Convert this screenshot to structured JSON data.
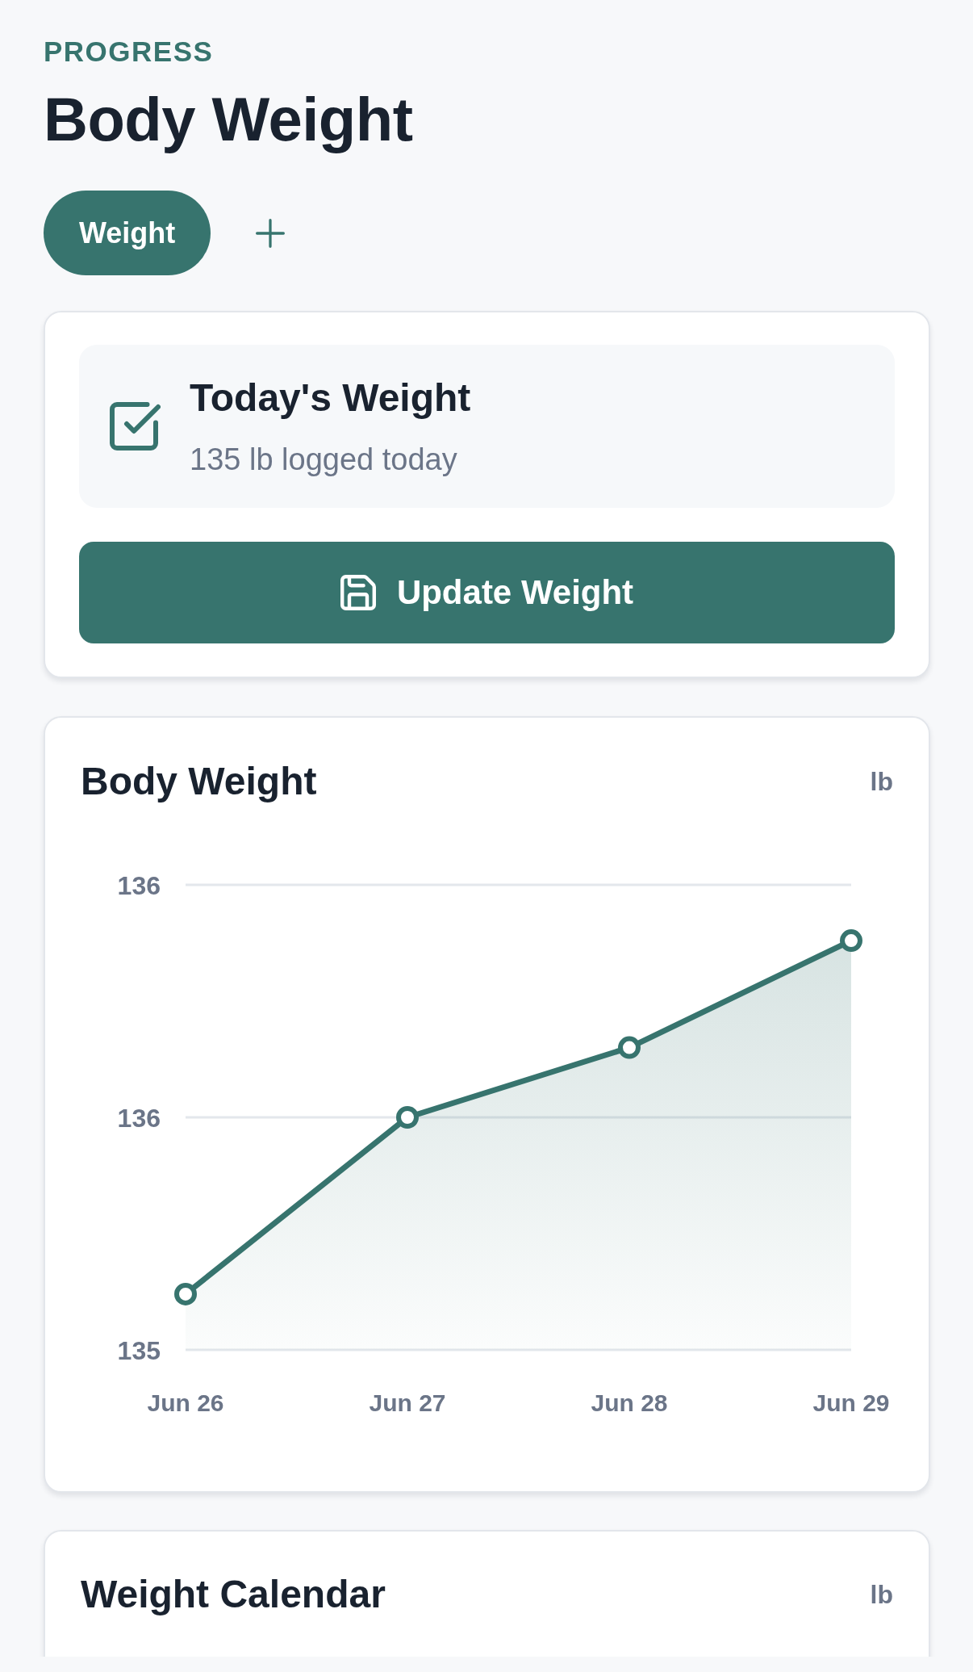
{
  "header": {
    "eyebrow": "PROGRESS",
    "title": "Body Weight"
  },
  "tabs": [
    {
      "label": "Weight",
      "selected": true
    }
  ],
  "today_card": {
    "title": "Today's Weight",
    "subtitle": "135 lb logged today",
    "button": "Update Weight"
  },
  "chart_card": {
    "unit": "lb",
    "chart_data": {
      "type": "area",
      "title": "Body Weight",
      "categories": [
        "Jun 26",
        "Jun 27",
        "Jun 28",
        "Jun 29"
      ],
      "values": [
        135.12,
        135.5,
        135.65,
        135.88
      ],
      "ylim": [
        135,
        136
      ],
      "yticks": [
        135,
        {
          "value": 135.5,
          "label": "136"
        },
        136
      ]
    }
  },
  "calendar_card": {
    "title": "Weight Calendar",
    "unit": "lb"
  }
}
